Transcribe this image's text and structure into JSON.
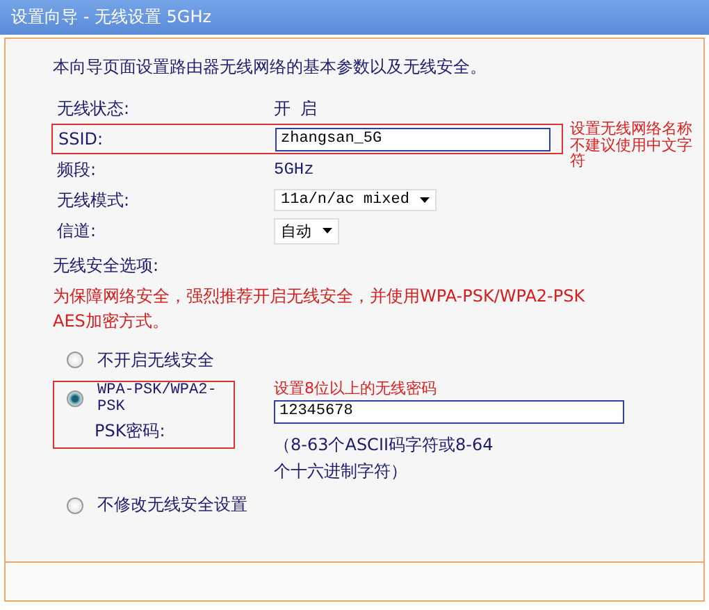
{
  "window": {
    "title": "设置向导 - 无线设置 5GHz"
  },
  "intro": "本向导页面设置路由器无线网络的基本参数以及无线安全。",
  "fields": [
    {
      "kind": "text",
      "label": "无线状态:",
      "value": "开 启"
    },
    {
      "kind": "input",
      "label": "SSID:",
      "value": "zhangsan_5G",
      "highlighted": true
    },
    {
      "kind": "text",
      "label": "频段:",
      "value": "5GHz"
    },
    {
      "kind": "select",
      "label": "无线模式:",
      "value": "11a/n/ac mixed"
    },
    {
      "kind": "select",
      "label": "信道:",
      "value": "自动"
    }
  ],
  "ssid_note": [
    "设置无线网络名称",
    "不建议使用中文字",
    "符"
  ],
  "security": {
    "label": "无线安全选项:",
    "warning": "为保障网络安全，强烈推荐开启无线安全，并使用WPA-PSK/WPA2-PSK AES加密方式。",
    "options": [
      {
        "label": "不开启无线安全",
        "selected": false
      },
      {
        "label": "WPA-PSK/WPA2-PSK",
        "selected": true,
        "password": {
          "label": "PSK密码:",
          "value": "12345678",
          "note": "设置8位以上的无线密码",
          "hint": "（8-63个ASCII码字符或8-64个十六进制字符）"
        }
      },
      {
        "label": "不修改无线安全设置",
        "selected": false
      }
    ]
  }
}
